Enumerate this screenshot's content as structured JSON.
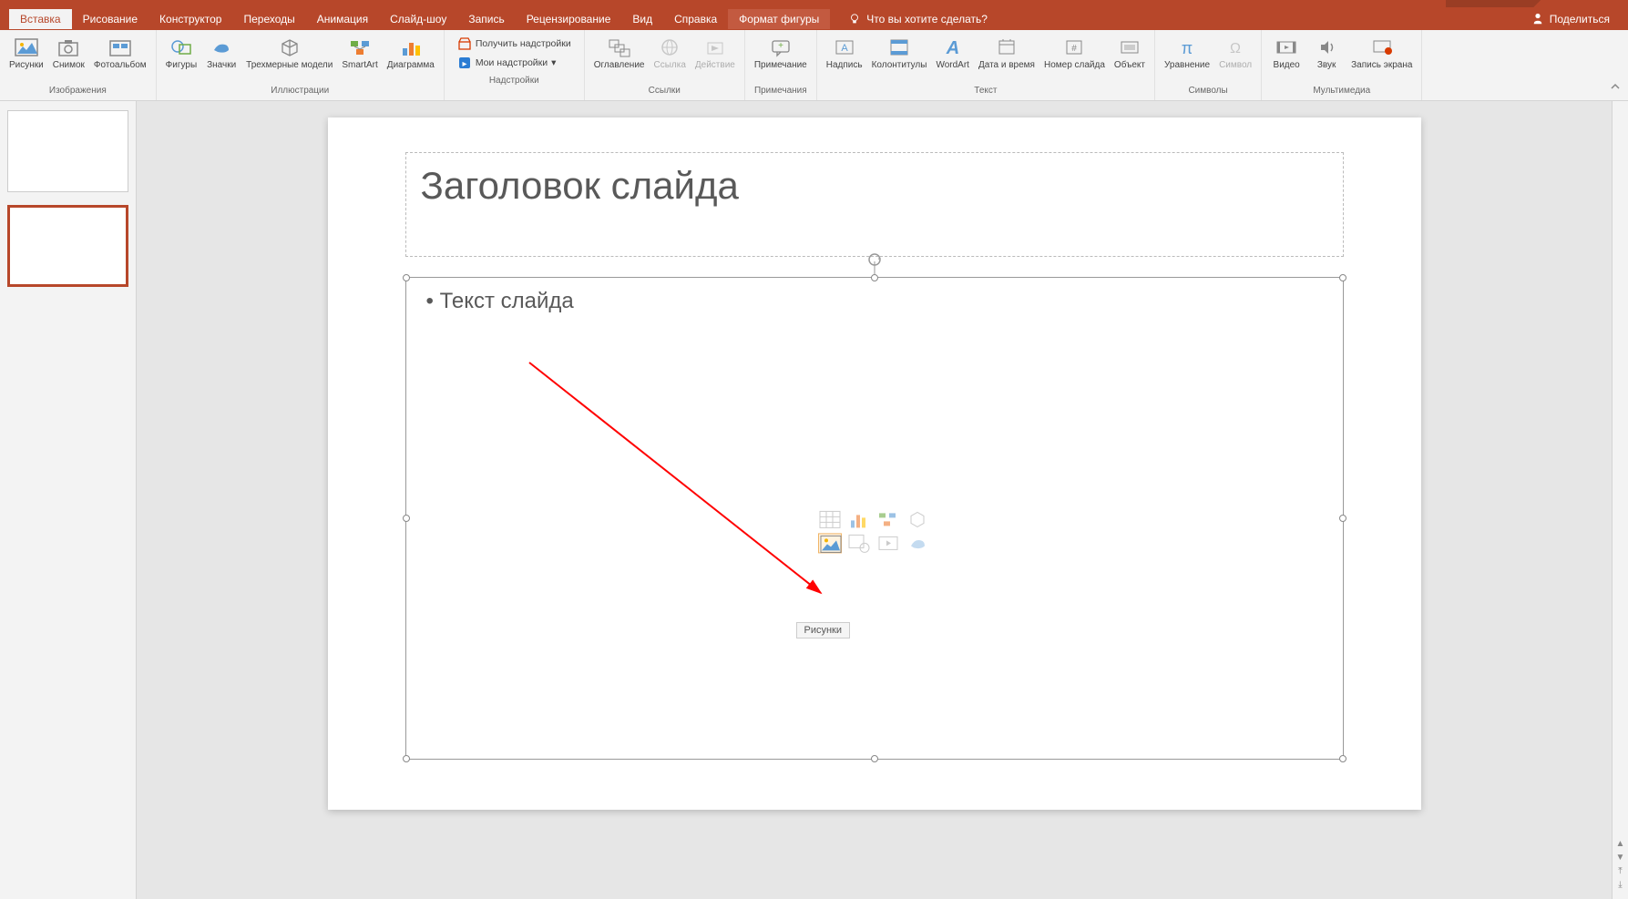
{
  "tabs": {
    "items": [
      "Вставка",
      "Рисование",
      "Конструктор",
      "Переходы",
      "Анимация",
      "Слайд-шоу",
      "Запись",
      "Рецензирование",
      "Вид",
      "Справка",
      "Формат фигуры"
    ],
    "active_index": 0,
    "contextual_index": 10
  },
  "tell_me": "Что вы хотите сделать?",
  "share": "Поделиться",
  "ribbon": {
    "groups": [
      {
        "label": "Изображения",
        "items": [
          {
            "name": "pictures",
            "label": "Рисунки",
            "icon": "image"
          },
          {
            "name": "screenshot",
            "label": "Снимок",
            "icon": "camera",
            "dropdown": true
          },
          {
            "name": "album",
            "label": "Фотоальбом",
            "icon": "album",
            "dropdown": true
          }
        ]
      },
      {
        "label": "Иллюстрации",
        "items": [
          {
            "name": "shapes",
            "label": "Фигуры",
            "icon": "shapes",
            "dropdown": true
          },
          {
            "name": "icons",
            "label": "Значки",
            "icon": "bird"
          },
          {
            "name": "3dmodels",
            "label": "Трехмерные модели",
            "icon": "cube",
            "dropdown": true
          },
          {
            "name": "smartart",
            "label": "SmartArt",
            "icon": "smartart"
          },
          {
            "name": "chart",
            "label": "Диаграмма",
            "icon": "chart"
          }
        ]
      },
      {
        "label": "Надстройки",
        "stack": [
          {
            "name": "getaddins",
            "label": "Получить надстройки",
            "icon": "store"
          },
          {
            "name": "myaddins",
            "label": "Мои надстройки",
            "icon": "addin",
            "dropdown": true
          }
        ]
      },
      {
        "label": "Ссылки",
        "items": [
          {
            "name": "toc",
            "label": "Оглавление",
            "icon": "zoom",
            "dropdown": true
          },
          {
            "name": "link",
            "label": "Ссылка",
            "icon": "link",
            "disabled": true
          },
          {
            "name": "action",
            "label": "Действие",
            "icon": "action",
            "disabled": true
          }
        ]
      },
      {
        "label": "Примечания",
        "items": [
          {
            "name": "comment",
            "label": "Примечание",
            "icon": "comment"
          }
        ]
      },
      {
        "label": "Текст",
        "items": [
          {
            "name": "textbox",
            "label": "Надпись",
            "icon": "textbox"
          },
          {
            "name": "headerfooter",
            "label": "Колонтитулы",
            "icon": "headerfooter"
          },
          {
            "name": "wordart",
            "label": "WordArt",
            "icon": "wordart",
            "dropdown": true
          },
          {
            "name": "datetime",
            "label": "Дата и время",
            "icon": "datetime"
          },
          {
            "name": "slidenumber",
            "label": "Номер слайда",
            "icon": "number"
          },
          {
            "name": "object",
            "label": "Объект",
            "icon": "object"
          }
        ]
      },
      {
        "label": "Символы",
        "items": [
          {
            "name": "equation",
            "label": "Уравнение",
            "icon": "equation",
            "dropdown": true
          },
          {
            "name": "symbol",
            "label": "Символ",
            "icon": "symbol",
            "disabled": true
          }
        ]
      },
      {
        "label": "Мультимедиа",
        "items": [
          {
            "name": "video",
            "label": "Видео",
            "icon": "video",
            "dropdown": true
          },
          {
            "name": "audio",
            "label": "Звук",
            "icon": "audio",
            "dropdown": true
          },
          {
            "name": "screenrec",
            "label": "Запись экрана",
            "icon": "screenrec"
          }
        ]
      }
    ]
  },
  "slide": {
    "title": "Заголовок слайда",
    "content": "• Текст слайда",
    "tooltip": "Рисунки"
  }
}
